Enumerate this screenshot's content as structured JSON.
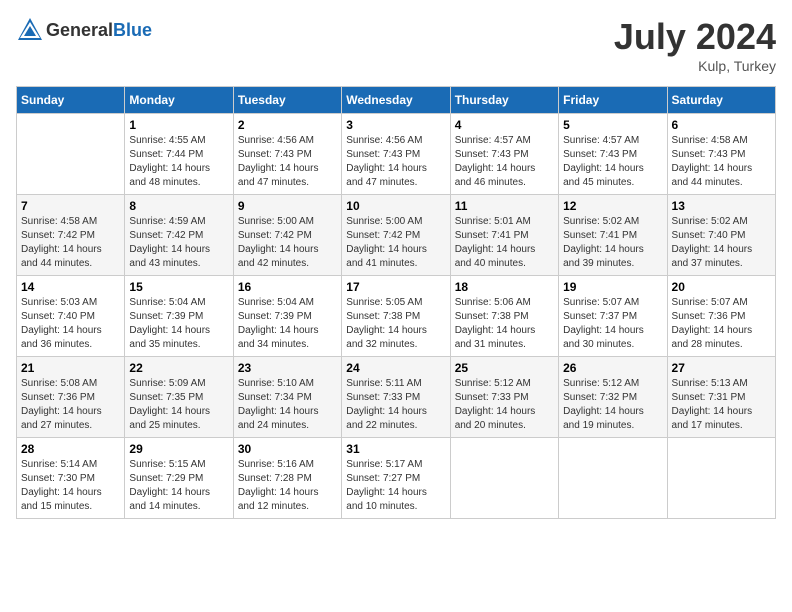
{
  "header": {
    "logo_general": "General",
    "logo_blue": "Blue",
    "month_title": "July 2024",
    "location": "Kulp, Turkey"
  },
  "calendar": {
    "days_of_week": [
      "Sunday",
      "Monday",
      "Tuesday",
      "Wednesday",
      "Thursday",
      "Friday",
      "Saturday"
    ],
    "weeks": [
      [
        {
          "day": "",
          "info": ""
        },
        {
          "day": "1",
          "info": "Sunrise: 4:55 AM\nSunset: 7:44 PM\nDaylight: 14 hours\nand 48 minutes."
        },
        {
          "day": "2",
          "info": "Sunrise: 4:56 AM\nSunset: 7:43 PM\nDaylight: 14 hours\nand 47 minutes."
        },
        {
          "day": "3",
          "info": "Sunrise: 4:56 AM\nSunset: 7:43 PM\nDaylight: 14 hours\nand 47 minutes."
        },
        {
          "day": "4",
          "info": "Sunrise: 4:57 AM\nSunset: 7:43 PM\nDaylight: 14 hours\nand 46 minutes."
        },
        {
          "day": "5",
          "info": "Sunrise: 4:57 AM\nSunset: 7:43 PM\nDaylight: 14 hours\nand 45 minutes."
        },
        {
          "day": "6",
          "info": "Sunrise: 4:58 AM\nSunset: 7:43 PM\nDaylight: 14 hours\nand 44 minutes."
        }
      ],
      [
        {
          "day": "7",
          "info": "Sunrise: 4:58 AM\nSunset: 7:42 PM\nDaylight: 14 hours\nand 44 minutes."
        },
        {
          "day": "8",
          "info": "Sunrise: 4:59 AM\nSunset: 7:42 PM\nDaylight: 14 hours\nand 43 minutes."
        },
        {
          "day": "9",
          "info": "Sunrise: 5:00 AM\nSunset: 7:42 PM\nDaylight: 14 hours\nand 42 minutes."
        },
        {
          "day": "10",
          "info": "Sunrise: 5:00 AM\nSunset: 7:42 PM\nDaylight: 14 hours\nand 41 minutes."
        },
        {
          "day": "11",
          "info": "Sunrise: 5:01 AM\nSunset: 7:41 PM\nDaylight: 14 hours\nand 40 minutes."
        },
        {
          "day": "12",
          "info": "Sunrise: 5:02 AM\nSunset: 7:41 PM\nDaylight: 14 hours\nand 39 minutes."
        },
        {
          "day": "13",
          "info": "Sunrise: 5:02 AM\nSunset: 7:40 PM\nDaylight: 14 hours\nand 37 minutes."
        }
      ],
      [
        {
          "day": "14",
          "info": "Sunrise: 5:03 AM\nSunset: 7:40 PM\nDaylight: 14 hours\nand 36 minutes."
        },
        {
          "day": "15",
          "info": "Sunrise: 5:04 AM\nSunset: 7:39 PM\nDaylight: 14 hours\nand 35 minutes."
        },
        {
          "day": "16",
          "info": "Sunrise: 5:04 AM\nSunset: 7:39 PM\nDaylight: 14 hours\nand 34 minutes."
        },
        {
          "day": "17",
          "info": "Sunrise: 5:05 AM\nSunset: 7:38 PM\nDaylight: 14 hours\nand 32 minutes."
        },
        {
          "day": "18",
          "info": "Sunrise: 5:06 AM\nSunset: 7:38 PM\nDaylight: 14 hours\nand 31 minutes."
        },
        {
          "day": "19",
          "info": "Sunrise: 5:07 AM\nSunset: 7:37 PM\nDaylight: 14 hours\nand 30 minutes."
        },
        {
          "day": "20",
          "info": "Sunrise: 5:07 AM\nSunset: 7:36 PM\nDaylight: 14 hours\nand 28 minutes."
        }
      ],
      [
        {
          "day": "21",
          "info": "Sunrise: 5:08 AM\nSunset: 7:36 PM\nDaylight: 14 hours\nand 27 minutes."
        },
        {
          "day": "22",
          "info": "Sunrise: 5:09 AM\nSunset: 7:35 PM\nDaylight: 14 hours\nand 25 minutes."
        },
        {
          "day": "23",
          "info": "Sunrise: 5:10 AM\nSunset: 7:34 PM\nDaylight: 14 hours\nand 24 minutes."
        },
        {
          "day": "24",
          "info": "Sunrise: 5:11 AM\nSunset: 7:33 PM\nDaylight: 14 hours\nand 22 minutes."
        },
        {
          "day": "25",
          "info": "Sunrise: 5:12 AM\nSunset: 7:33 PM\nDaylight: 14 hours\nand 20 minutes."
        },
        {
          "day": "26",
          "info": "Sunrise: 5:12 AM\nSunset: 7:32 PM\nDaylight: 14 hours\nand 19 minutes."
        },
        {
          "day": "27",
          "info": "Sunrise: 5:13 AM\nSunset: 7:31 PM\nDaylight: 14 hours\nand 17 minutes."
        }
      ],
      [
        {
          "day": "28",
          "info": "Sunrise: 5:14 AM\nSunset: 7:30 PM\nDaylight: 14 hours\nand 15 minutes."
        },
        {
          "day": "29",
          "info": "Sunrise: 5:15 AM\nSunset: 7:29 PM\nDaylight: 14 hours\nand 14 minutes."
        },
        {
          "day": "30",
          "info": "Sunrise: 5:16 AM\nSunset: 7:28 PM\nDaylight: 14 hours\nand 12 minutes."
        },
        {
          "day": "31",
          "info": "Sunrise: 5:17 AM\nSunset: 7:27 PM\nDaylight: 14 hours\nand 10 minutes."
        },
        {
          "day": "",
          "info": ""
        },
        {
          "day": "",
          "info": ""
        },
        {
          "day": "",
          "info": ""
        }
      ]
    ]
  }
}
